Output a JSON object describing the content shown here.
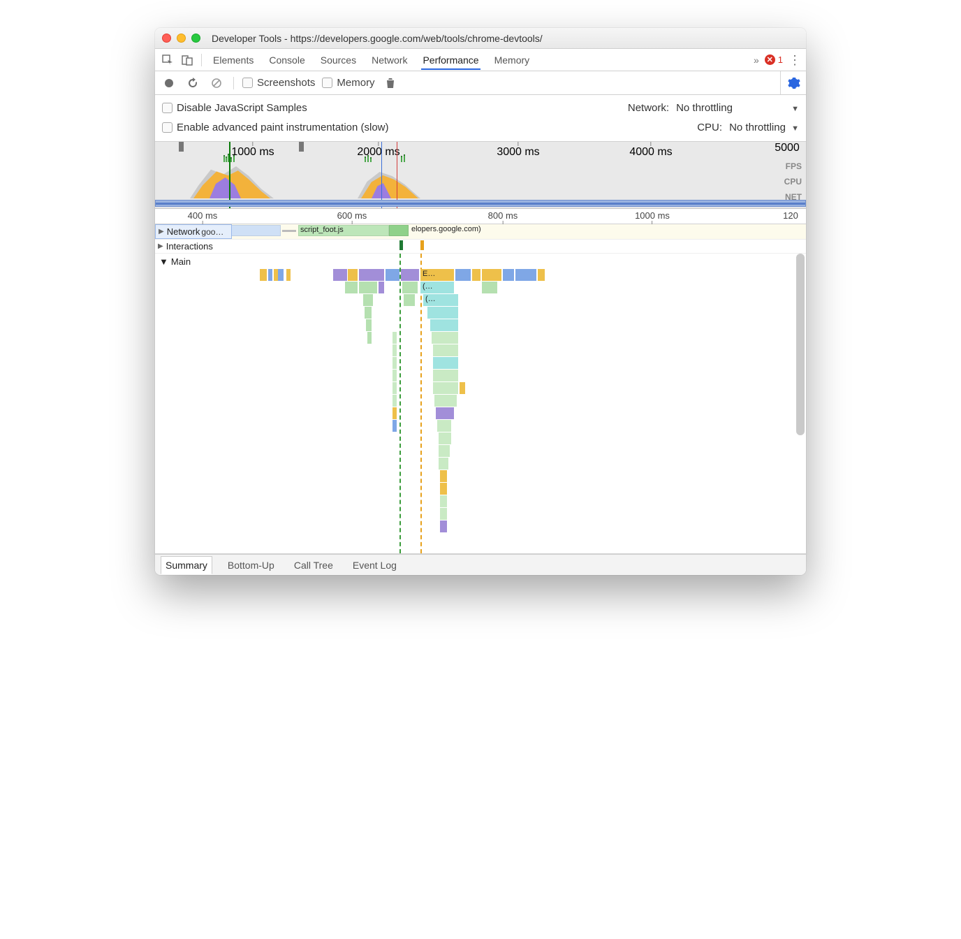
{
  "window": {
    "title": "Developer Tools - https://developers.google.com/web/tools/chrome-devtools/"
  },
  "tabs": {
    "items": [
      "Elements",
      "Console",
      "Sources",
      "Network",
      "Performance",
      "Memory"
    ],
    "active": "Performance",
    "errors_count": "1"
  },
  "toolbar": {
    "screenshots_label": "Screenshots",
    "memory_label": "Memory"
  },
  "options": {
    "disable_js_samples": "Disable JavaScript Samples",
    "enable_paint_instr": "Enable advanced paint instrumentation (slow)",
    "network_label": "Network:",
    "network_value": "No throttling",
    "cpu_label": "CPU:",
    "cpu_value": "No throttling"
  },
  "overview": {
    "ticks": [
      "1000 ms",
      "2000 ms",
      "3000 ms",
      "4000 ms",
      "5000"
    ],
    "lane_labels": [
      "FPS",
      "CPU",
      "NET"
    ]
  },
  "zoom_ruler": {
    "ticks": [
      "400 ms",
      "600 ms",
      "800 ms",
      "1000 ms",
      "120"
    ]
  },
  "tracks": {
    "network_label": "Network",
    "network_bar1": "goo…",
    "network_bar2": "script_foot.js",
    "network_bar3": "elopers.google.com)",
    "interactions_label": "Interactions",
    "main_label": "Main",
    "flame_e_label": "E…",
    "flame_p1_label": "(…",
    "flame_p2_label": "(…"
  },
  "bottom_tabs": {
    "items": [
      "Summary",
      "Bottom-Up",
      "Call Tree",
      "Event Log"
    ],
    "active": "Summary"
  }
}
